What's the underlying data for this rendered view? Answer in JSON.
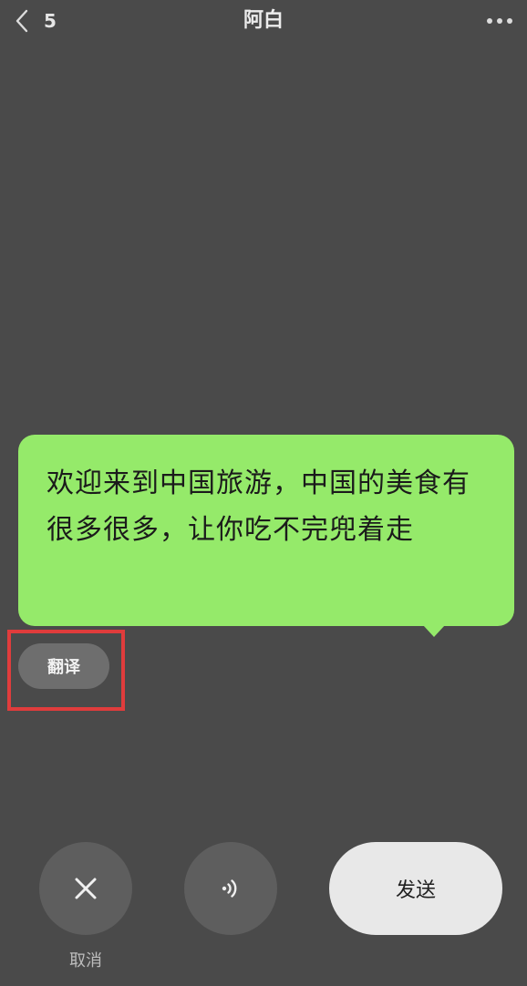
{
  "header": {
    "unread_count": "5",
    "title": "阿白",
    "back_icon": "chevron-left-icon",
    "more_icon": "more-dots-icon"
  },
  "message": {
    "text": "欢迎来到中国旅游，中国的美食有很多很多，让你吃不完兜着走"
  },
  "translate": {
    "label": "翻译"
  },
  "actions": {
    "cancel_label": "取消",
    "cancel_icon": "close-icon",
    "voice_icon": "speaker-icon",
    "send_label": "发送"
  },
  "colors": {
    "background": "#4a4a4a",
    "bubble": "#95ea6a",
    "highlight": "#e03c3c",
    "send_button": "#e8e8e8",
    "round_button": "#5e5e5e"
  }
}
